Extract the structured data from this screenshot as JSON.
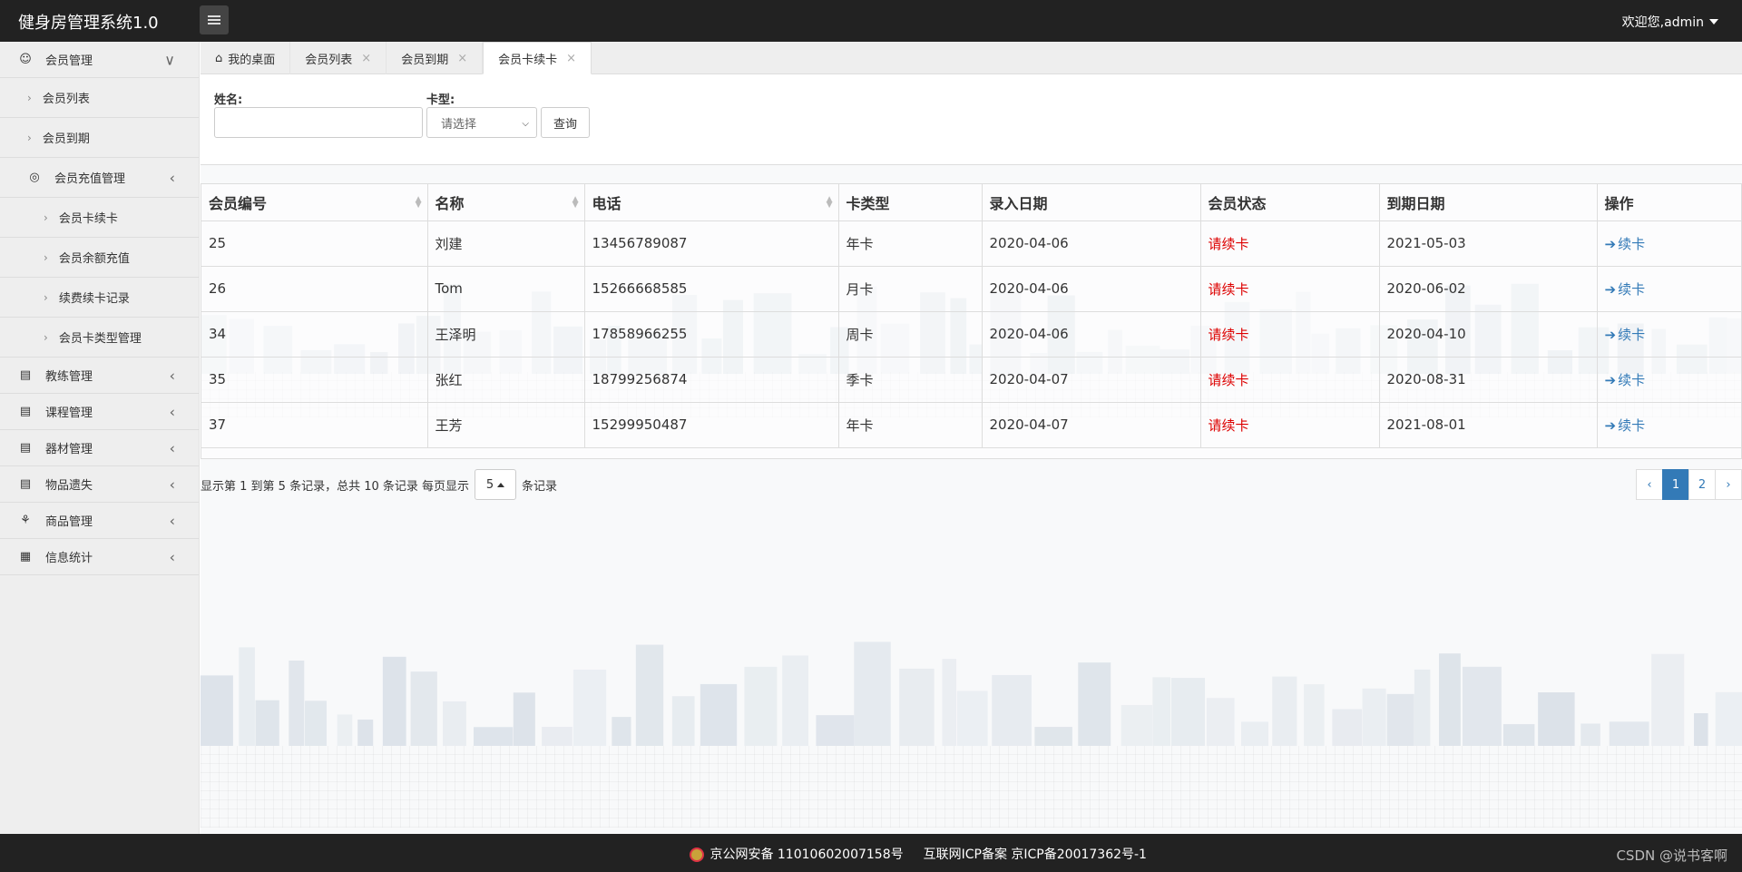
{
  "header": {
    "app_title": "健身房管理系统1.0",
    "welcome": "欢迎您,admin"
  },
  "sidebar": {
    "items": [
      {
        "label": "会员管理",
        "level": 0,
        "icon": "user-icon",
        "state": "expanded"
      },
      {
        "label": "会员列表",
        "level": 1
      },
      {
        "label": "会员到期",
        "level": 1
      },
      {
        "label": "会员充值管理",
        "level": 1,
        "icon": "user-circle-icon",
        "state": "expanded"
      },
      {
        "label": "会员卡续卡",
        "level": 2
      },
      {
        "label": "会员余额充值",
        "level": 2
      },
      {
        "label": "续费续卡记录",
        "level": 2
      },
      {
        "label": "会员卡类型管理",
        "level": 2
      },
      {
        "label": "教练管理",
        "level": 0,
        "icon": "document-icon",
        "state": "collapsed"
      },
      {
        "label": "课程管理",
        "level": 0,
        "icon": "document-icon",
        "state": "collapsed"
      },
      {
        "label": "器材管理",
        "level": 0,
        "icon": "document-icon",
        "state": "collapsed"
      },
      {
        "label": "物品遗失",
        "level": 0,
        "icon": "document-icon",
        "state": "collapsed"
      },
      {
        "label": "商品管理",
        "level": 0,
        "icon": "shopping-icon",
        "state": "collapsed"
      },
      {
        "label": "信息统计",
        "level": 0,
        "icon": "grid-icon",
        "state": "collapsed"
      }
    ]
  },
  "tabs": [
    {
      "label": "我的桌面",
      "closable": false,
      "icon": "home-icon"
    },
    {
      "label": "会员列表",
      "closable": true
    },
    {
      "label": "会员到期",
      "closable": true
    },
    {
      "label": "会员卡续卡",
      "closable": true,
      "active": true
    }
  ],
  "filter": {
    "name_label": "姓名:",
    "name_value": "",
    "card_label": "卡型:",
    "card_select": "请选择",
    "query_button": "查询"
  },
  "table": {
    "columns": [
      "会员编号",
      "名称",
      "电话",
      "卡类型",
      "录入日期",
      "会员状态",
      "到期日期",
      "操作"
    ],
    "rows": [
      [
        "25",
        "刘建",
        "13456789087",
        "年卡",
        "2020-04-06",
        "请续卡",
        "2021-05-03",
        "续卡"
      ],
      [
        "26",
        "Tom",
        "15266668585",
        "月卡",
        "2020-04-06",
        "请续卡",
        "2020-06-02",
        "续卡"
      ],
      [
        "34",
        "王泽明",
        "17858966255",
        "周卡",
        "2020-04-06",
        "请续卡",
        "2020-04-10",
        "续卡"
      ],
      [
        "35",
        "张红",
        "18799256874",
        "季卡",
        "2020-04-07",
        "请续卡",
        "2020-08-31",
        "续卡"
      ],
      [
        "37",
        "王芳",
        "15299950487",
        "年卡",
        "2020-04-07",
        "请续卡",
        "2021-08-01",
        "续卡"
      ]
    ]
  },
  "pager": {
    "info_prefix": "显示第 1 到第 5 条记录，总共 10 条记录 每页显示",
    "page_size": "5",
    "info_suffix": "条记录",
    "prev": "‹",
    "pages": [
      "1",
      "2"
    ],
    "current": "1",
    "next": "›"
  },
  "footer": {
    "police": "京公网安备 11010602007158号",
    "icp": "互联网ICP备案 京ICP备20017362号-1",
    "watermark": "CSDN @说书客啊"
  },
  "colors": {
    "status_red": "#dd0000",
    "link_blue": "#337ab7",
    "dark_bar": "#222222"
  }
}
